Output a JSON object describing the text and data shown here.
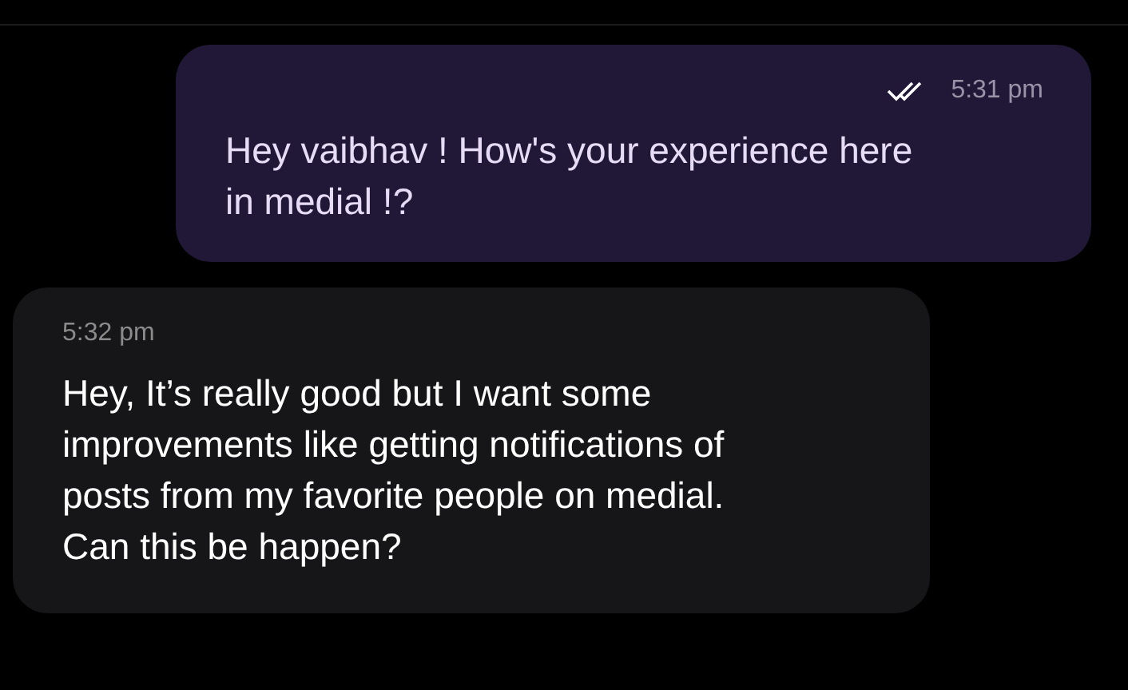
{
  "messages": [
    {
      "kind": "outgoing",
      "read": true,
      "time": "5:31 pm",
      "text": "Hey vaibhav ! How's your experience here in medial !?"
    },
    {
      "kind": "incoming",
      "time": "5:32 pm",
      "text": "Hey, It’s really good but I want some improvements like getting notifications of posts from my favorite people on medial. Can this be happen?"
    }
  ]
}
